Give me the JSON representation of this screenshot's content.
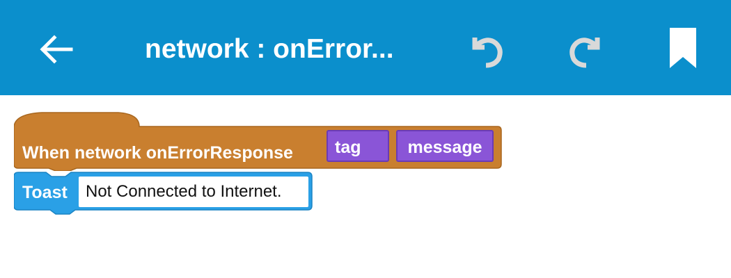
{
  "appbar": {
    "title": "network : onError...",
    "icons": {
      "back": "back-arrow-icon",
      "undo": "undo-icon",
      "redo": "redo-icon",
      "bookmark": "bookmark-icon"
    }
  },
  "colors": {
    "appbar": "#0b8fcc",
    "event_block": "#c97f2f",
    "param_block": "#8a55d7",
    "toast_block": "#2aa0e6"
  },
  "blocks": {
    "event": {
      "label": "When network onErrorResponse",
      "params": [
        {
          "label": "tag"
        },
        {
          "label": "message"
        }
      ]
    },
    "toast": {
      "label": "Toast",
      "value": "Not Connected to Internet."
    }
  }
}
